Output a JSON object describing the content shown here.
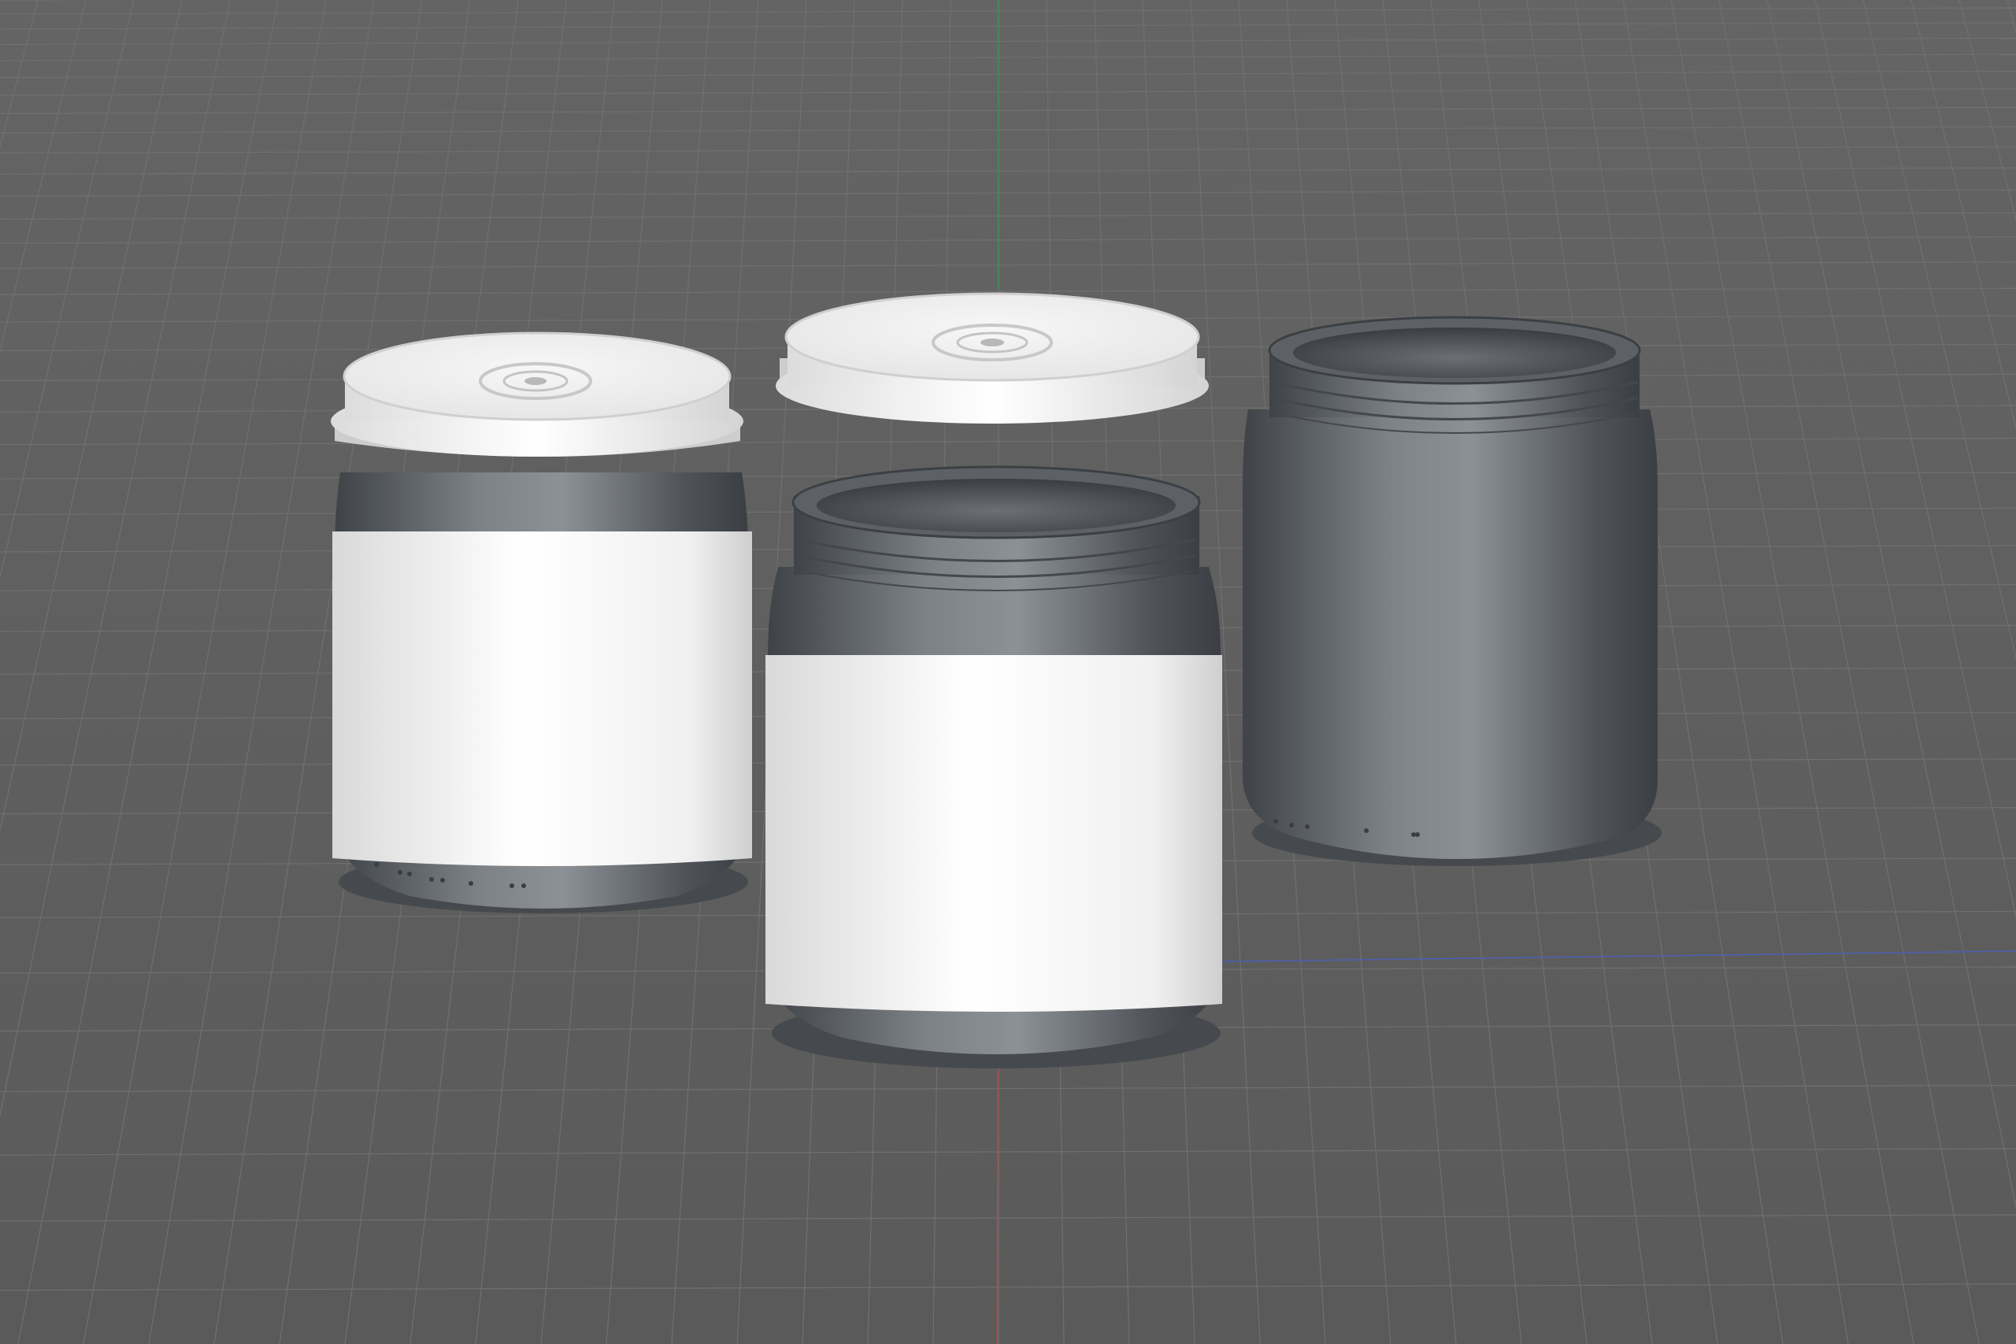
{
  "viewport": {
    "background_color": "#5f5f5f",
    "grid_color": "#707070",
    "axis_colors": {
      "y_axis": "#3f8f5a",
      "x_axis": "#4d5fb8",
      "z_axis": "#b04a4a"
    }
  },
  "scene": {
    "objects": [
      {
        "name": "jar-with-lid-and-label",
        "lid": "on",
        "label": "blank-white"
      },
      {
        "name": "jar-with-label-lid-floating",
        "lid": "floating-above",
        "label": "blank-white"
      },
      {
        "name": "jar-bare-open",
        "lid": "none",
        "label": "none"
      }
    ],
    "colors": {
      "jar_body": "#4f5358",
      "jar_body_highlight": "#8c9196",
      "label": "#f4f4f4",
      "lid": "#f2f2f2"
    }
  }
}
